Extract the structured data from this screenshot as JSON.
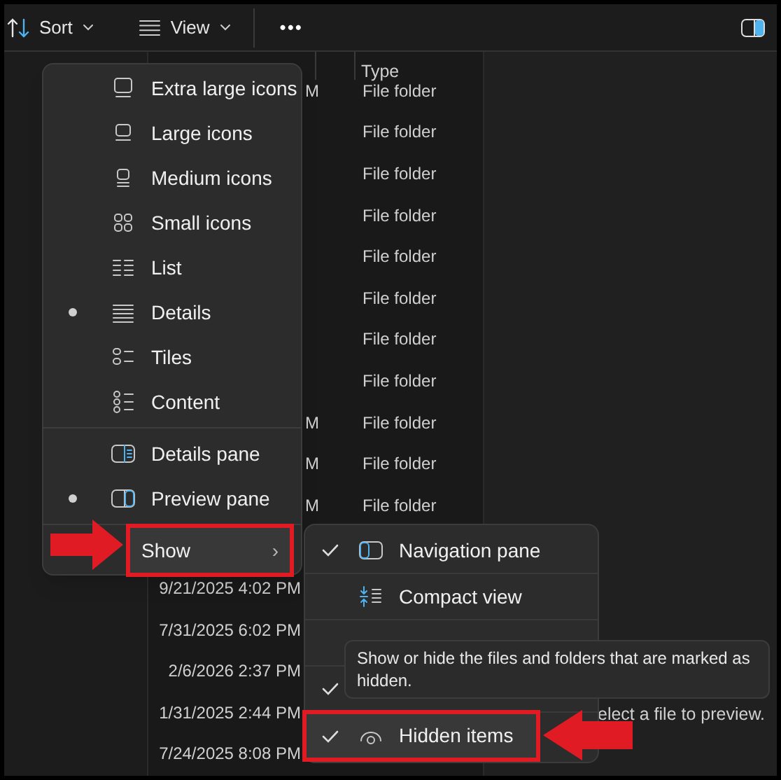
{
  "toolbar": {
    "sort_label": "Sort",
    "view_label": "View",
    "more": "•••"
  },
  "file_list": {
    "columns": [
      {
        "label": "Type"
      }
    ],
    "rows": [
      {
        "date": "M",
        "type": "File folder"
      },
      {
        "type": "File folder"
      },
      {
        "type": "File folder"
      },
      {
        "type": "File folder"
      },
      {
        "type": "File folder"
      },
      {
        "type": "File folder"
      },
      {
        "type": "File folder"
      },
      {
        "type": "File folder"
      },
      {
        "date": "M",
        "type": "File folder"
      },
      {
        "date": "M",
        "type": "File folder"
      },
      {
        "date": "M",
        "type": "File folder"
      }
    ],
    "lower_rows": [
      {
        "date": "9/21/2025 4:02 PM"
      },
      {
        "date": "7/31/2025 6:02 PM"
      },
      {
        "date": "2/6/2026 2:37 PM"
      },
      {
        "date": "1/31/2025 2:44 PM"
      },
      {
        "date": "7/24/2025 8:08 PM"
      }
    ]
  },
  "preview_pane": {
    "message": "elect a file to preview."
  },
  "view_menu": {
    "layouts": [
      {
        "kind": "xl",
        "label": "Extra large icons",
        "selected": false
      },
      {
        "kind": "large",
        "label": "Large icons",
        "selected": false
      },
      {
        "kind": "medium",
        "label": "Medium icons",
        "selected": false
      },
      {
        "kind": "small",
        "label": "Small icons",
        "selected": false
      },
      {
        "kind": "list",
        "label": "List",
        "selected": false
      },
      {
        "kind": "details",
        "label": "Details",
        "selected": true
      },
      {
        "kind": "tiles",
        "label": "Tiles",
        "selected": false
      },
      {
        "kind": "content",
        "label": "Content",
        "selected": false
      }
    ],
    "panes": [
      {
        "kind": "details_pane",
        "label": "Details pane",
        "selected": false
      },
      {
        "kind": "preview_pane",
        "label": "Preview pane",
        "selected": true
      }
    ],
    "show": {
      "label": "Show",
      "chevron": "›",
      "highlighted": true
    }
  },
  "show_menu": {
    "items": [
      {
        "kind": "navigation",
        "label": "Navigation pane",
        "checked": true
      },
      {
        "kind": "compact",
        "label": "Compact view",
        "checked": false
      },
      {
        "kind": "covered",
        "checked": false
      },
      {
        "kind": "covered",
        "checked": true
      },
      {
        "kind": "hidden",
        "label": "Hidden items",
        "checked": true,
        "highlighted": true
      }
    ]
  },
  "tooltip": {
    "text": "Show or hide the files and folders that are marked as hidden."
  }
}
